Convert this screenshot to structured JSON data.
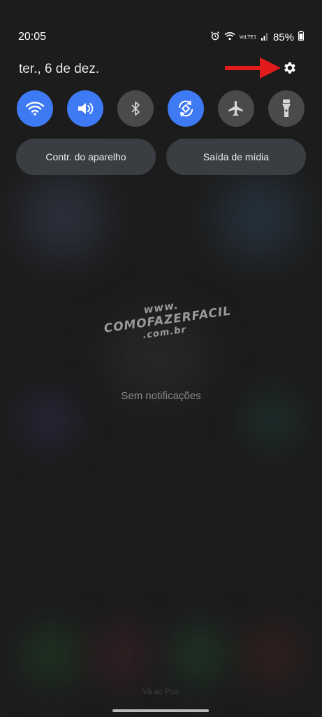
{
  "status_bar": {
    "time": "20:05",
    "battery_percent": "85%",
    "network_label": "VoLTE1"
  },
  "date": "ter., 6 de dez.",
  "quick_toggles": [
    {
      "name": "wifi",
      "icon": "wifi-icon",
      "state": "on"
    },
    {
      "name": "sound",
      "icon": "volume-icon",
      "state": "on"
    },
    {
      "name": "bluetooth",
      "icon": "bluetooth-icon",
      "state": "off"
    },
    {
      "name": "auto-rotate",
      "icon": "auto-rotate-icon",
      "state": "on"
    },
    {
      "name": "airplane-mode",
      "icon": "airplane-icon",
      "state": "off"
    },
    {
      "name": "flashlight",
      "icon": "flashlight-icon",
      "state": "off"
    }
  ],
  "buttons": {
    "device_control": "Contr. do aparelho",
    "media_output": "Saída de mídia"
  },
  "notifications": {
    "empty_text": "Sem notificações"
  },
  "watermark": {
    "line1": "www.",
    "line2": "COMOFAZERFACIL",
    "line3": ".com.br"
  },
  "bottom_hint": "Vá ao Play",
  "colors": {
    "accent": "#3f7af5",
    "toggle_off": "#4a4a4a",
    "pill_bg": "#3a3e42",
    "arrow": "#e31b1b",
    "background": "#1c1c1c"
  }
}
